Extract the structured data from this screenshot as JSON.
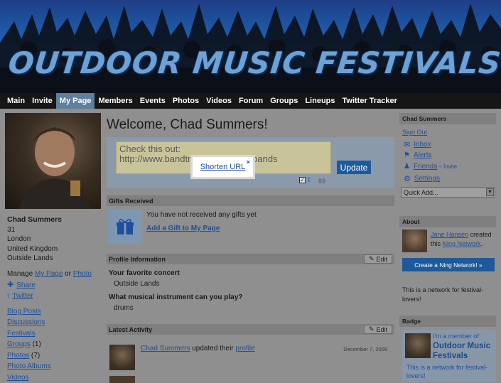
{
  "site": {
    "title": "OUTDOOR MUSIC FESTIVALS"
  },
  "nav": {
    "items": [
      "Main",
      "Invite",
      "My Page",
      "Members",
      "Events",
      "Photos",
      "Videos",
      "Forum",
      "Groups",
      "Lineups",
      "Twitter Tracker"
    ],
    "active": "My Page"
  },
  "profile": {
    "name": "Chad Summers",
    "age": "31",
    "city": "London",
    "country": "United Kingdom",
    "extra": "Outside Lands",
    "manage_prefix": "Manage",
    "manage_link1": "My Page",
    "manage_or": "or",
    "manage_link2": "Photo",
    "share": "Share",
    "twitter": "Twitter",
    "links": [
      "Blog Posts",
      "Discussions",
      "Festivals",
      "Groups",
      "Photos",
      "Photo Albums",
      "Videos"
    ],
    "groups_count": "(1)",
    "photos_count": "(7)"
  },
  "main": {
    "welcome": "Welcome, Chad Summers!",
    "status_text": "Check this out: http://www.bandtracker.com/newbands",
    "update_label": "Update",
    "char_count": "89",
    "popup_link": "Shorten URL",
    "popup_close": "×",
    "gifts_header": "Gifts Received",
    "gifts_empty": "You have not received any gifts yet",
    "gifts_add": "Add a Gift to My Page",
    "profile_header": "Profile Information",
    "edit_label": "Edit",
    "q1": "Your favorite concert",
    "a1": "Outside Lands",
    "q2": "What musical instrument can you play?",
    "a2": "drums",
    "activity_header": "Latest Activity",
    "activity_user": "Chad Summers",
    "activity_middle": "updated their",
    "activity_link": "profile",
    "activity_date": "December 7, 2009"
  },
  "right": {
    "user_header": "Chad Summers",
    "sign_out": "Sign Out",
    "inbox": "Inbox",
    "alerts": "Alerts",
    "friends": "Friends",
    "friends_invite": "– Invite",
    "settings": "Settings",
    "quick_add": "Quick Add...",
    "about_header": "About",
    "about_user": "Jane Hansen",
    "about_created": "created",
    "about_this": "this",
    "about_network": "Ning Network",
    "about_period": ".",
    "ning_button": "Create a Ning Network! »",
    "network_desc": "This is a network for festival-lovers!",
    "badge_header": "Badge",
    "badge_member": "I'm a member of:",
    "badge_name": "Outdoor Music Festivals",
    "badge_desc": "This is a network for festival-lovers!"
  },
  "colors": {
    "accent": "#1d5a9c",
    "nav_active": "#5e7f9f",
    "link": "#1f4f9c"
  }
}
